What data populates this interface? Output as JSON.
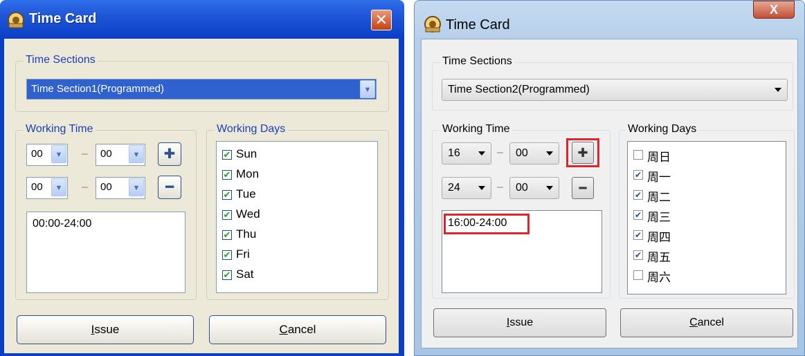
{
  "xp_window": {
    "title": "Time Card",
    "close_glyph": "✕",
    "time_sections_label": "Time Sections",
    "time_section_value": "Time Section1(Programmed)",
    "working_time_label": "Working Time",
    "start_hour": "00",
    "start_minute": "00",
    "end_hour": "00",
    "end_minute": "00",
    "dash": "–",
    "add_glyph": "✚",
    "remove_glyph": "━",
    "time_list": [
      "00:00-24:00"
    ],
    "working_days_label": "Working Days",
    "days": [
      {
        "label": "Sun",
        "checked": true
      },
      {
        "label": "Mon",
        "checked": true
      },
      {
        "label": "Tue",
        "checked": true
      },
      {
        "label": "Wed",
        "checked": true
      },
      {
        "label": "Thu",
        "checked": true
      },
      {
        "label": "Fri",
        "checked": true
      },
      {
        "label": "Sat",
        "checked": true
      }
    ],
    "issue_first": "I",
    "issue_rest": "ssue",
    "cancel_first": "C",
    "cancel_rest": "ancel"
  },
  "win7_window": {
    "title": "Time Card",
    "close_glyph": "X",
    "time_sections_label": "Time Sections",
    "time_section_value": "Time Section2(Programmed)",
    "working_time_label": "Working Time",
    "start_hour": "16",
    "start_minute": "00",
    "end_hour": "24",
    "end_minute": "00",
    "dash": "–",
    "add_glyph": "✚",
    "remove_glyph": "━",
    "time_list": [
      "16:00-24:00"
    ],
    "working_days_label": "Working Days",
    "days": [
      {
        "label": "周日",
        "checked": false
      },
      {
        "label": "周一",
        "checked": true
      },
      {
        "label": "周二",
        "checked": true
      },
      {
        "label": "周三",
        "checked": true
      },
      {
        "label": "周四",
        "checked": true
      },
      {
        "label": "周五",
        "checked": true
      },
      {
        "label": "周六",
        "checked": false
      }
    ],
    "issue_first": "I",
    "issue_rest": "ssue",
    "cancel_first": "C",
    "cancel_rest": "ancel"
  },
  "colors": {
    "xp_title_blue": "#0a3fc4",
    "xp_face": "#ece9d8",
    "xp_selection": "#2f61cf",
    "xp_label_blue": "#1b3fb8",
    "win7_face": "#f0f0f0",
    "highlight_red": "#e0242b"
  }
}
